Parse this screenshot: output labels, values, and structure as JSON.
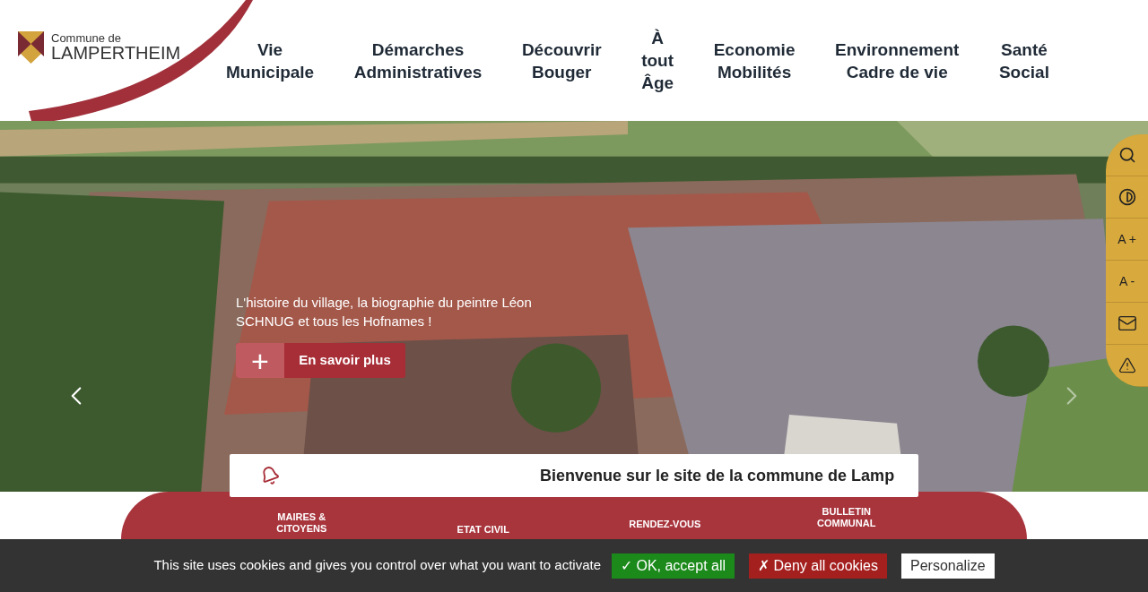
{
  "logo": {
    "line1": "Commune de",
    "line2": "LAMPERTHEIM"
  },
  "nav": [
    {
      "lines": [
        "Vie",
        "Municipale"
      ]
    },
    {
      "lines": [
        "Démarches",
        "Administratives"
      ]
    },
    {
      "lines": [
        "Découvrir",
        "Bouger"
      ]
    },
    {
      "lines": [
        "À",
        "tout",
        "Âge"
      ]
    },
    {
      "lines": [
        "Economie",
        "Mobilités"
      ]
    },
    {
      "lines": [
        "Environnement",
        "Cadre de vie"
      ]
    },
    {
      "lines": [
        "Santé",
        "Social"
      ]
    }
  ],
  "hero": {
    "caption": "L'histoire du village, la biographie du peintre Léon SCHNUG et tous les Hofnames !",
    "plus": "+",
    "button": "En savoir plus"
  },
  "accessibility": [
    {
      "kind": "search"
    },
    {
      "kind": "contrast"
    },
    {
      "kind": "text",
      "label": "A +"
    },
    {
      "kind": "text",
      "label": "A -"
    },
    {
      "kind": "mail"
    },
    {
      "kind": "alert"
    }
  ],
  "welcome": "Bienvenue sur le site de la commune de Lamp",
  "tiles": [
    {
      "label": "MAIRES & CITOYENS"
    },
    {
      "label": "ETAT CIVIL"
    },
    {
      "label": "RENDEZ-VOUS"
    },
    {
      "label": "BULLETIN COMMUNAL"
    }
  ],
  "cookies": {
    "message": "This site uses cookies and gives you control over what you want to activate",
    "buttons": [
      {
        "kind": "accept",
        "label": "✓ OK, accept all"
      },
      {
        "kind": "deny",
        "label": "✗ Deny all cookies"
      },
      {
        "kind": "personalize",
        "label": "Personalize"
      }
    ]
  }
}
